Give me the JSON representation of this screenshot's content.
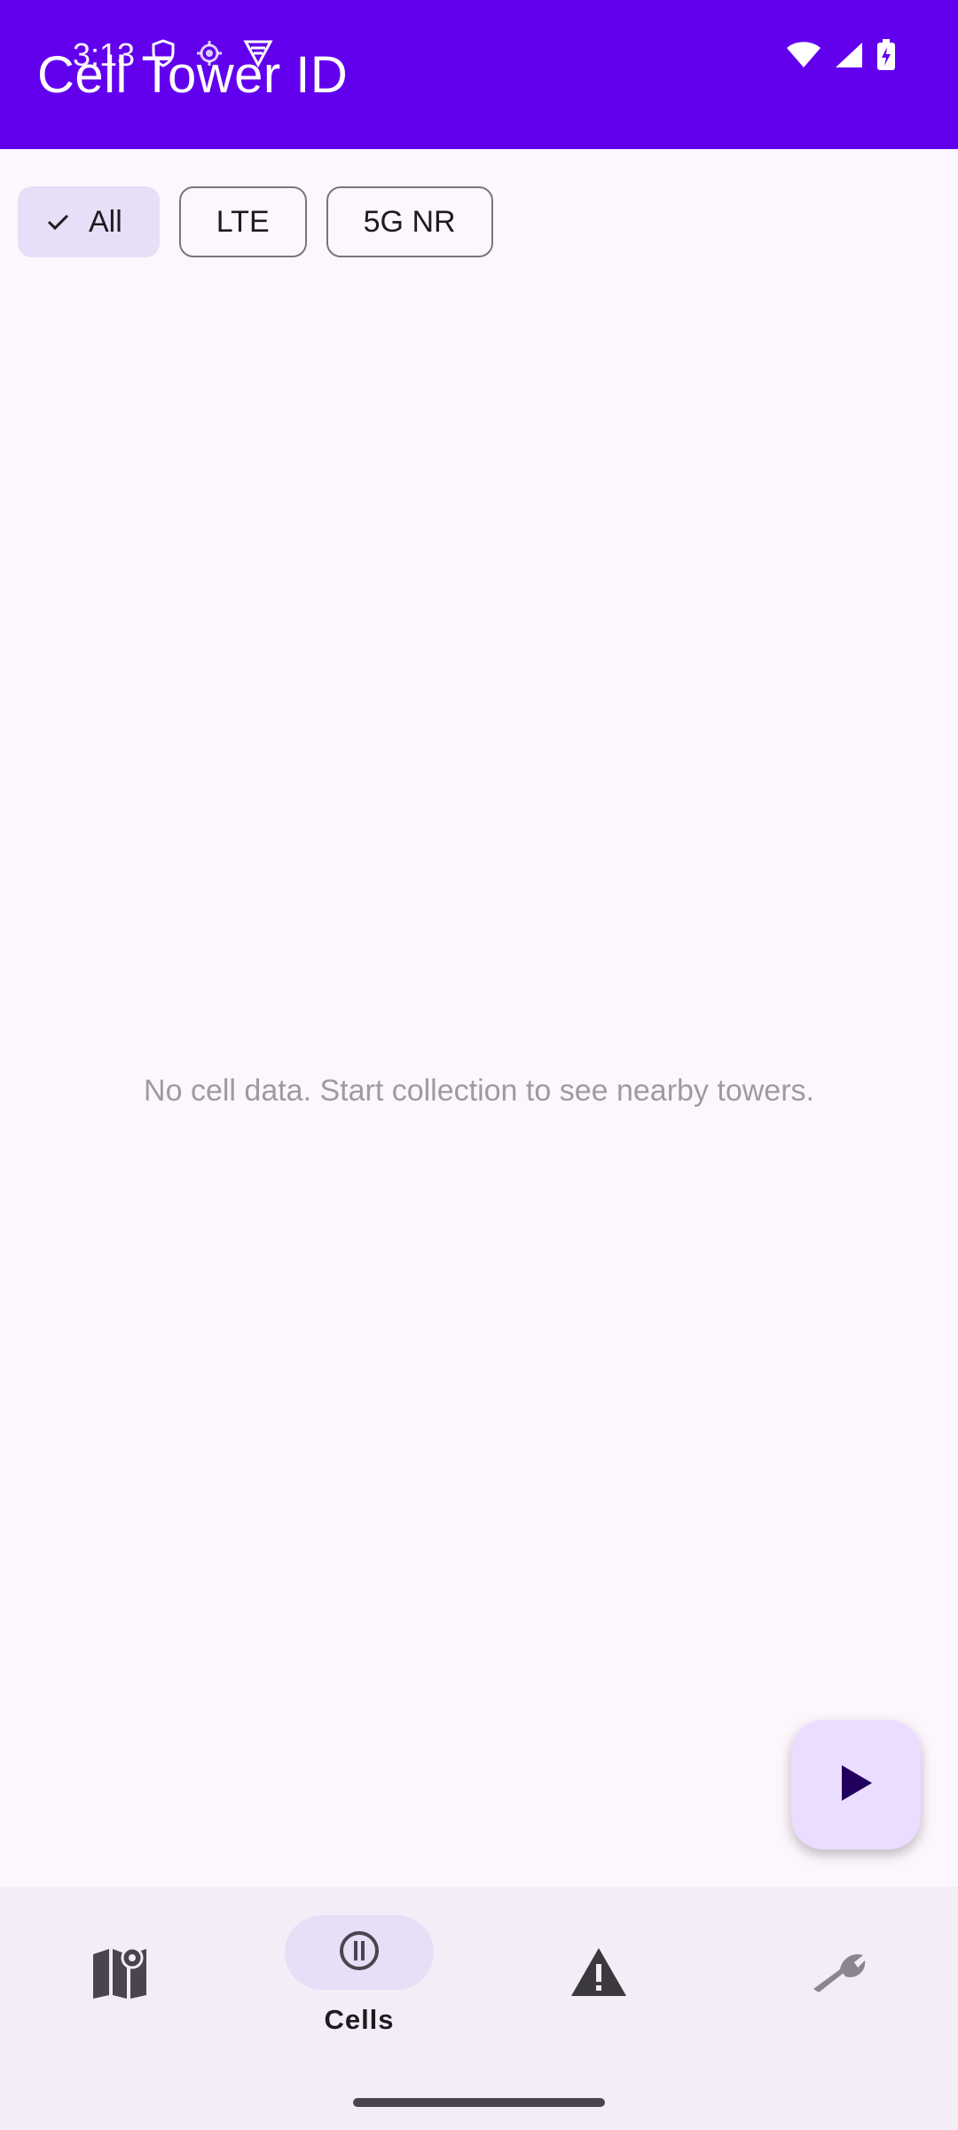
{
  "status_bar": {
    "time": "3:13"
  },
  "app_bar": {
    "title": "Cell Tower ID"
  },
  "filters": [
    {
      "label": "All",
      "selected": true
    },
    {
      "label": "LTE",
      "selected": false
    },
    {
      "label": "5G NR",
      "selected": false
    }
  ],
  "main": {
    "empty_message": "No cell data. Start collection to see nearby towers."
  },
  "fab": {
    "icon": "play-icon"
  },
  "bottom_nav": {
    "items": [
      {
        "icon": "map-icon",
        "label": "",
        "active": false
      },
      {
        "icon": "info-icon",
        "label": "Cells",
        "active": true
      },
      {
        "icon": "warning-icon",
        "label": "",
        "active": false
      },
      {
        "icon": "wrench-icon",
        "label": "",
        "active": false
      }
    ]
  },
  "colors": {
    "primary": "#6200ee",
    "background": "#fdf7fd",
    "chip_selected": "#e8def8",
    "fab": "#eaddff",
    "nav_background": "#f3edf7",
    "empty_text": "#9e9aa3"
  }
}
